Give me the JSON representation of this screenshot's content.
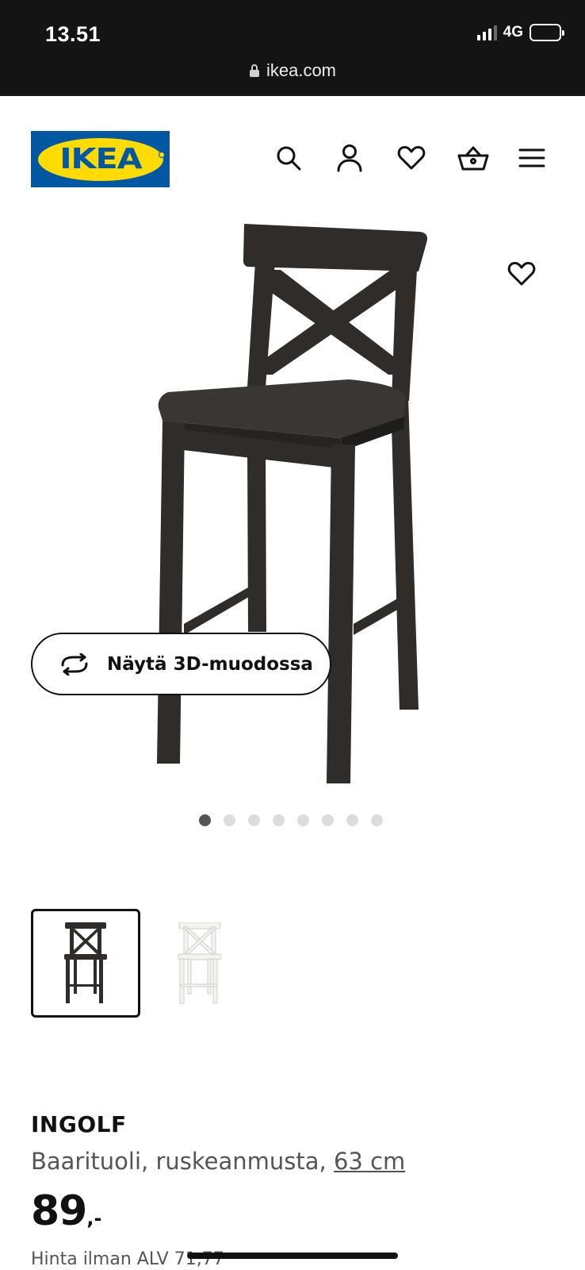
{
  "status_bar": {
    "time": "13.51",
    "network": "4G",
    "url": "ikea.com"
  },
  "header": {
    "logo_text": "IKEA",
    "icons": [
      "search-icon",
      "account-icon",
      "heart-icon",
      "basket-icon",
      "menu-icon"
    ]
  },
  "gallery": {
    "view_3d_label": "Näytä 3D-muodossa",
    "dot_count": 8,
    "active_dot": 1,
    "thumbnails": [
      {
        "color": "brown-black",
        "selected": true
      },
      {
        "color": "white",
        "selected": false
      }
    ]
  },
  "product": {
    "name": "INGOLF",
    "description": "Baarituoli, ruskeanmusta, ",
    "size": "63 cm",
    "price_int": "89",
    "price_dec": ",-",
    "price_vat": "Hinta ilman ALV 71,77"
  },
  "colors": {
    "brand_blue": "#0058a3",
    "brand_yellow": "#ffdb00",
    "text_primary": "#111111",
    "text_secondary": "#555555",
    "chair_brown_black": "#2f2c29"
  }
}
